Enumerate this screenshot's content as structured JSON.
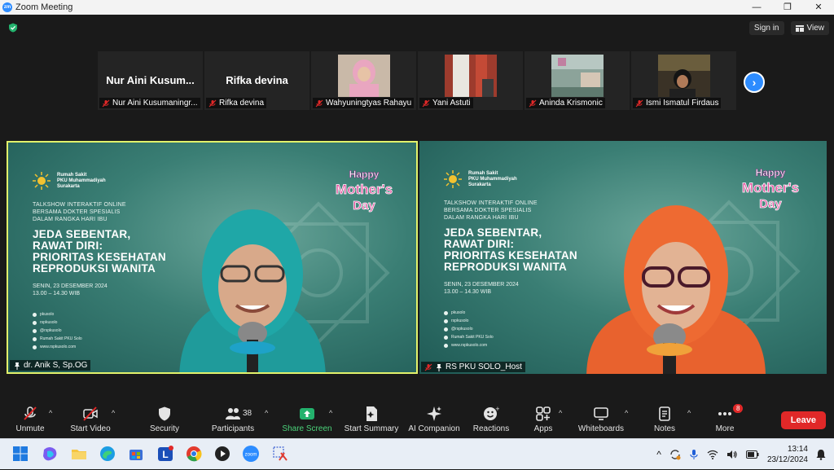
{
  "window": {
    "title": "Zoom Meeting",
    "logo": "zm",
    "controls": [
      "—",
      "❐",
      "✕"
    ]
  },
  "header": {
    "sign_in": "Sign in",
    "view": "View"
  },
  "participants_strip": [
    {
      "display": "Nur Aini Kusum...",
      "label": "Nur Aini Kusumaningr...",
      "has_video": false
    },
    {
      "display": "Rifka devina",
      "label": "Rifka devina",
      "has_video": false
    },
    {
      "display": "",
      "label": "Wahyuningtyas Rahayu",
      "has_video": true
    },
    {
      "display": "",
      "label": "Yani Astuti",
      "has_video": true
    },
    {
      "display": "",
      "label": "Aninda Krismonic",
      "has_video": true
    },
    {
      "display": "",
      "label": "Ismi Ismatul Firdaus",
      "has_video": true
    }
  ],
  "slide": {
    "org_line1": "Rumah Sakit",
    "org_line2": "PKU Muhammadiyah",
    "org_line3": "Surakarta",
    "talkshow_line1": "TALKSHOW INTERAKTIF ONLINE",
    "talkshow_line2": "BERSAMA DOKTER SPESIALIS",
    "talkshow_line3": "DALAM RANGKA HARI IBU",
    "headline_line1": "JEDA SEBENTAR,",
    "headline_line2": "RAWAT DIRI:",
    "headline_line3": "PRIORITAS KESEHATAN",
    "headline_line4": "REPRODUKSI WANITA",
    "date_line1": "SENIN, 23 DESEMBER 2024",
    "date_line2": "13.00 – 14.30 WIB",
    "badge_line1": "Happy",
    "badge_line2": "Mother's",
    "badge_line3": "Day",
    "socials": [
      "pkusolo",
      "rspkusolo",
      "@rspkusolo",
      "Rumah Sakit PKU Solo",
      "www.rspkusolo.com"
    ]
  },
  "speakers": {
    "left_name": "dr. Anik S, Sp.OG",
    "right_name": "RS PKU SOLO_Host"
  },
  "toolbar": {
    "unmute": "Unmute",
    "start_video": "Start Video",
    "security": "Security",
    "participants": "Participants",
    "participants_count": "38",
    "share_screen": "Share Screen",
    "start_summary": "Start Summary",
    "ai_companion": "AI Companion",
    "reactions": "Reactions",
    "apps": "Apps",
    "whiteboards": "Whiteboards",
    "notes": "Notes",
    "more": "More",
    "more_badge": "8",
    "leave": "Leave"
  },
  "taskbar": {
    "time": "13:14",
    "date": "23/12/2024",
    "zoom_label": "zoom"
  },
  "colors": {
    "accent": "#2d8cff",
    "leave": "#e02828",
    "active_border": "#e2f26b",
    "share": "#4bd37a"
  }
}
